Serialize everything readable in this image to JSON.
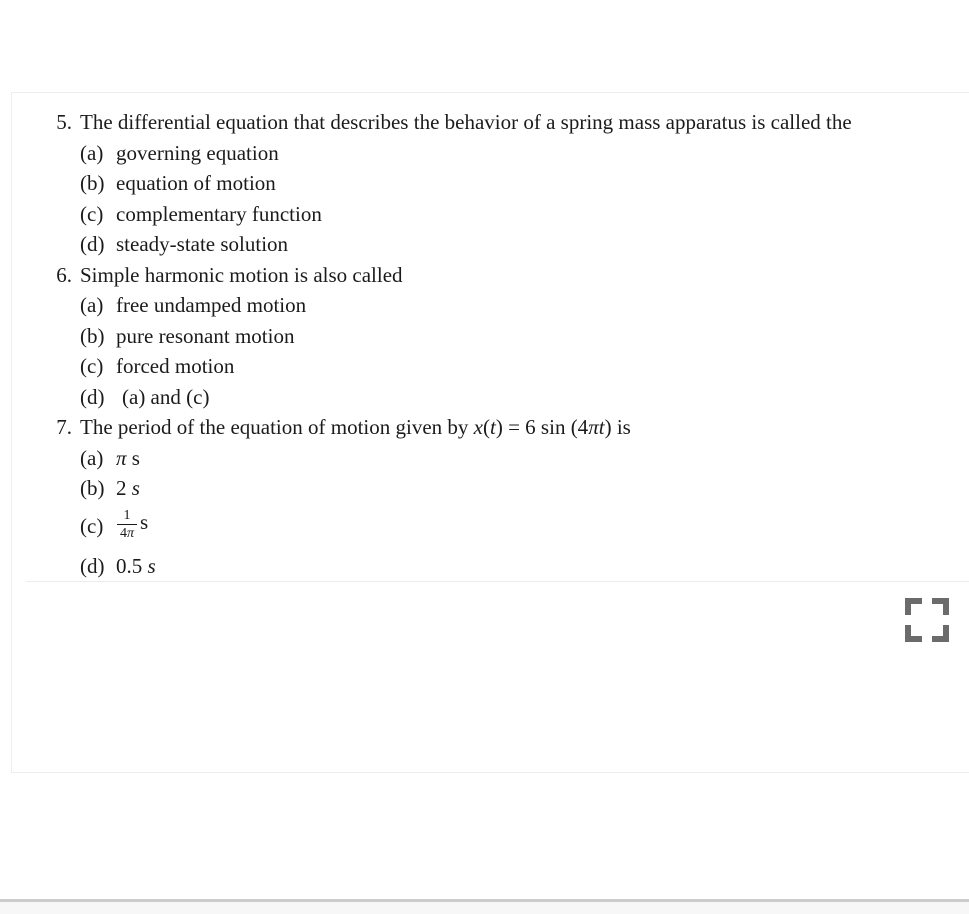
{
  "document": {
    "type": "multiple-choice-quiz-excerpt",
    "subject_context": "spring mass / simple harmonic motion"
  },
  "questions": [
    {
      "number": "5.",
      "stem": "The differential equation that describes the behavior of a spring mass apparatus is called the",
      "options": [
        {
          "label": "(a)",
          "text": "governing equation"
        },
        {
          "label": "(b)",
          "text": "equation of motion"
        },
        {
          "label": "(c)",
          "text": "complementary function"
        },
        {
          "label": "(d)",
          "text": "steady-state solution"
        }
      ]
    },
    {
      "number": "6.",
      "stem": "Simple harmonic motion is also called",
      "options": [
        {
          "label": "(a)",
          "text": "free undamped motion"
        },
        {
          "label": "(b)",
          "text": "pure resonant motion"
        },
        {
          "label": "(c)",
          "text": "forced motion"
        },
        {
          "label": "(d)",
          "text": "(a) and (c)"
        }
      ]
    },
    {
      "number": "7.",
      "stem_prefix": "The period of the equation of motion given by ",
      "stem_math_x": "x",
      "stem_math_paren_open": "(",
      "stem_math_t": "t",
      "stem_math_paren_close": ")",
      "stem_math_equals": " = 6 sin (4",
      "stem_math_pi": "π",
      "stem_math_t2": "t",
      "stem_math_tail": ")",
      "stem_suffix": " is",
      "options": [
        {
          "label": "(a)",
          "pi": "π",
          "unit": "s"
        },
        {
          "label": "(b)",
          "value": "2",
          "unit_italic": "s"
        },
        {
          "label": "(c)",
          "numerator": "1",
          "denominator_num": "4",
          "denominator_pi": "π",
          "unit": "s"
        },
        {
          "label": "(d)",
          "value": "0.5",
          "unit_italic": "s"
        }
      ]
    }
  ],
  "card": {
    "expand_icon_name": "expand-fullscreen-icon"
  },
  "colors": {
    "text": "#1b1b1b",
    "card_border": "#eeeeee",
    "divider": "#ececec",
    "icon": "#6b6b6b",
    "bottom_rule": "#cccccc",
    "bottom_strip": "#f7f7f7",
    "background": "#ffffff"
  }
}
